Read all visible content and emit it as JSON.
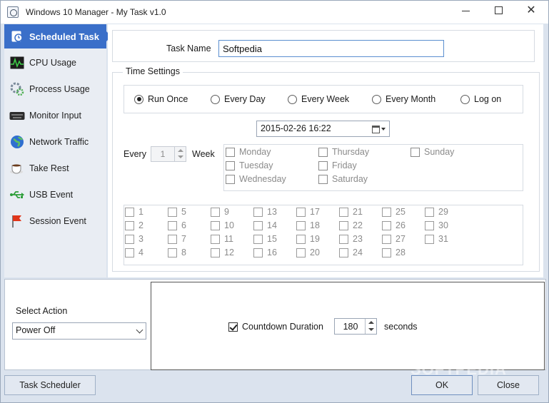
{
  "window": {
    "title": "Windows 10 Manager - My Task v1.0"
  },
  "sidebar": {
    "items": [
      {
        "label": "Scheduled Task",
        "icon": "scheduled-task-icon",
        "active": true
      },
      {
        "label": "CPU Usage",
        "icon": "cpu-usage-icon"
      },
      {
        "label": "Process Usage",
        "icon": "process-usage-icon"
      },
      {
        "label": "Monitor Input",
        "icon": "keyboard-icon"
      },
      {
        "label": "Network Traffic",
        "icon": "globe-icon"
      },
      {
        "label": "Take Rest",
        "icon": "coffee-cup-icon"
      },
      {
        "label": "USB Event",
        "icon": "usb-icon"
      },
      {
        "label": "Session Event",
        "icon": "flag-icon"
      }
    ]
  },
  "task": {
    "name_label": "Task Name",
    "name_value": "Softpedia"
  },
  "time": {
    "legend": "Time Settings",
    "modes": [
      "Run Once",
      "Every Day",
      "Every Week",
      "Every Month",
      "Log on"
    ],
    "selected_mode": "Run Once",
    "datetime": "2015-02-26 16:22",
    "every_label": "Every",
    "every_value": "1",
    "week_label": "Week",
    "weekdays": [
      "Monday",
      "Tuesday",
      "Wednesday",
      "Thursday",
      "Friday",
      "Saturday",
      "Sunday"
    ],
    "month_days": [
      "1",
      "2",
      "3",
      "4",
      "5",
      "6",
      "7",
      "8",
      "9",
      "10",
      "11",
      "12",
      "13",
      "14",
      "15",
      "16",
      "17",
      "18",
      "19",
      "20",
      "21",
      "22",
      "23",
      "24",
      "25",
      "26",
      "27",
      "28",
      "29",
      "30",
      "31"
    ]
  },
  "action": {
    "label": "Select Action",
    "selected": "Power Off",
    "countdown_label": "Countdown Duration",
    "countdown_checked": true,
    "countdown_value": "180",
    "seconds_label": "seconds"
  },
  "buttons": {
    "scheduler": "Task Scheduler",
    "ok": "OK",
    "close": "Close"
  },
  "watermark": "SOFTPEDIA",
  "colors": {
    "accent": "#3a6fc9",
    "frame": "#dbe3ee"
  }
}
